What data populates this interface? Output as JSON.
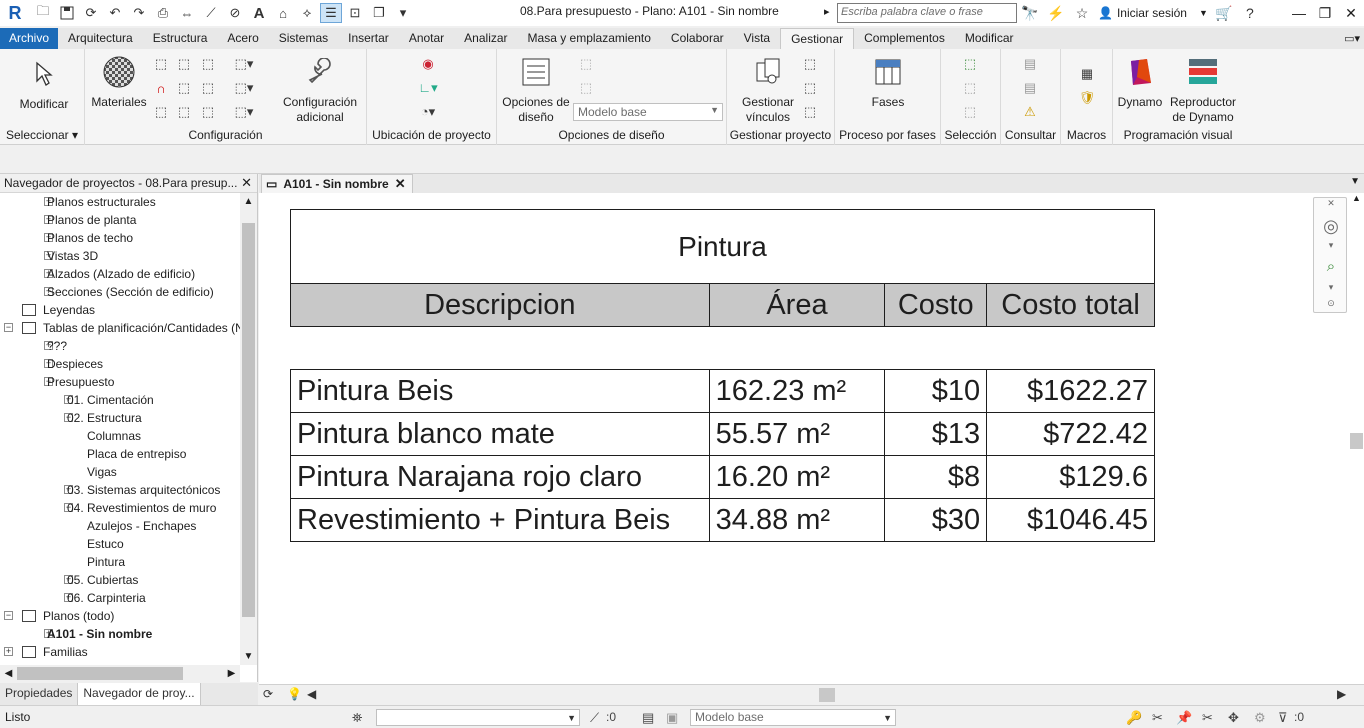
{
  "titlebar": {
    "doc_title": "08.Para presupuesto - Plano: A101 - Sin nombre",
    "search_placeholder": "Escriba palabra clave o frase",
    "signin_label": "Iniciar sesión"
  },
  "tabs": [
    "Archivo",
    "Arquitectura",
    "Estructura",
    "Acero",
    "Sistemas",
    "Insertar",
    "Anotar",
    "Analizar",
    "Masa y emplazamiento",
    "Colaborar",
    "Vista",
    "Gestionar",
    "Complementos",
    "Modificar"
  ],
  "active_tab": "Gestionar",
  "ribbon": {
    "modify_label": "Modificar",
    "select_panel": "Seleccionar",
    "materials_label": "Materiales",
    "config_adicional_label": "Configuración\nadicional",
    "config_panel": "Configuración",
    "location_panel": "Ubicación de proyecto",
    "design_options_label": "Opciones de\ndiseño",
    "design_combo_value": "Modelo base",
    "design_panel": "Opciones de diseño",
    "manage_links_label": "Gestionar\nvínculos",
    "manage_panel": "Gestionar proyecto",
    "phases_label": "Fases",
    "phases_panel": "Proceso por fases",
    "selection_panel": "Selección",
    "inquiry_panel": "Consultar",
    "macros_panel": "Macros",
    "dynamo_label": "Dynamo",
    "dynamo_player_label": "Reproductor\nde Dynamo",
    "visual_panel": "Programación visual"
  },
  "browser": {
    "title": "Navegador de proyectos - 08.Para presup...",
    "nodes": [
      {
        "label": "Planos estructurales",
        "level": 1,
        "toggle": "+"
      },
      {
        "label": "Planos de planta",
        "level": 1,
        "toggle": "+"
      },
      {
        "label": "Planos de techo",
        "level": 1,
        "toggle": "+"
      },
      {
        "label": "Vistas 3D",
        "level": 1,
        "toggle": "+"
      },
      {
        "label": "Alzados (Alzado de edificio)",
        "level": 1,
        "toggle": "+"
      },
      {
        "label": "Secciones (Sección de edificio)",
        "level": 1,
        "toggle": "+"
      },
      {
        "label": "Leyendas",
        "level": 0,
        "toggle": "",
        "icon": true
      },
      {
        "label": "Tablas de planificación/Cantidades (N",
        "level": 0,
        "toggle": "−",
        "icon": true
      },
      {
        "label": "???",
        "level": 1,
        "toggle": "+"
      },
      {
        "label": "Despieces",
        "level": 1,
        "toggle": "+"
      },
      {
        "label": "Presupuesto",
        "level": 1,
        "toggle": "−"
      },
      {
        "label": "01. Cimentación",
        "level": 2,
        "toggle": "+"
      },
      {
        "label": "02. Estructura",
        "level": 2,
        "toggle": "−"
      },
      {
        "label": "Columnas",
        "level": 3,
        "toggle": ""
      },
      {
        "label": "Placa de entrepiso",
        "level": 3,
        "toggle": ""
      },
      {
        "label": "Vigas",
        "level": 3,
        "toggle": ""
      },
      {
        "label": "03. Sistemas arquitectónicos",
        "level": 2,
        "toggle": "+"
      },
      {
        "label": "04. Revestimientos de muro",
        "level": 2,
        "toggle": "−"
      },
      {
        "label": "Azulejos - Enchapes",
        "level": 3,
        "toggle": ""
      },
      {
        "label": "Estuco",
        "level": 3,
        "toggle": ""
      },
      {
        "label": "Pintura",
        "level": 3,
        "toggle": ""
      },
      {
        "label": "05. Cubiertas",
        "level": 2,
        "toggle": "+"
      },
      {
        "label": "06. Carpinteria",
        "level": 2,
        "toggle": "+"
      },
      {
        "label": "Planos (todo)",
        "level": 0,
        "toggle": "−",
        "icon": true
      },
      {
        "label": "A101 - Sin nombre",
        "level": 1,
        "toggle": "+",
        "bold": true
      },
      {
        "label": "Familias",
        "level": 0,
        "toggle": "+",
        "icon": true
      }
    ],
    "bottom_tabs": [
      "Propiedades",
      "Navegador de proy..."
    ]
  },
  "view": {
    "tab_label": "A101 - Sin nombre"
  },
  "schedule": {
    "title": "Pintura",
    "headers": [
      "Descripcion",
      "Área",
      "Costo",
      "Costo total"
    ],
    "rows": [
      [
        "Pintura Beis",
        "162.23 m²",
        "$10",
        "$1622.27"
      ],
      [
        "Pintura blanco mate",
        "55.57 m²",
        "$13",
        "$722.42"
      ],
      [
        "Pintura Narajana rojo claro",
        "16.20 m²",
        "$8",
        "$129.6"
      ],
      [
        "Revestimiento + Pintura Beis",
        "34.88 m²",
        "$30",
        "$1046.45"
      ]
    ]
  },
  "status": {
    "text": "Listo",
    "count_a": ":0",
    "model_combo": "Modelo base",
    "filter_count": ":0"
  }
}
